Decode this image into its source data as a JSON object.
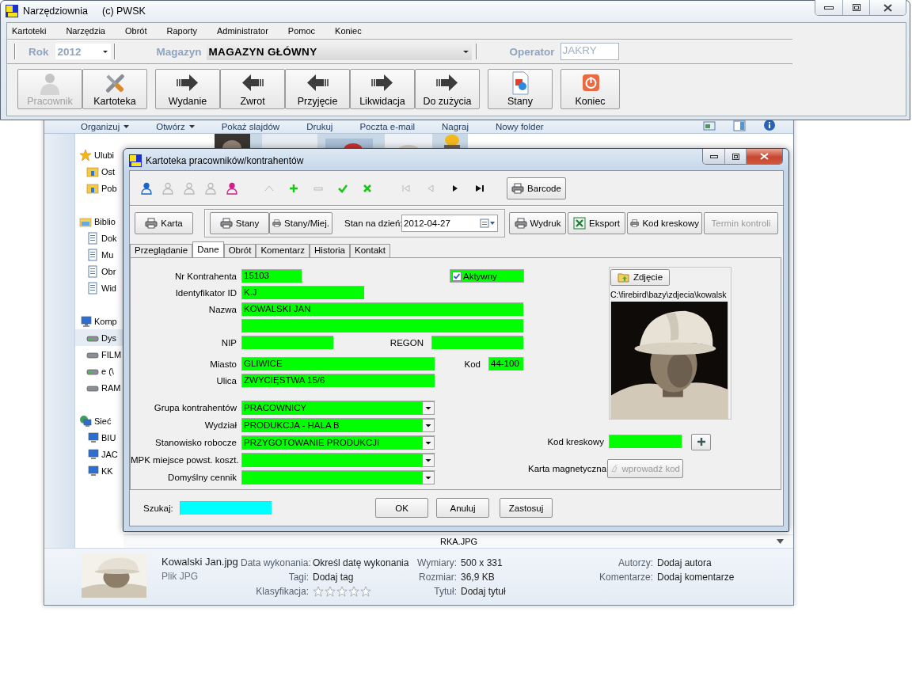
{
  "main_window": {
    "title": "Narzędziownia",
    "copyright": "(c) PWSK",
    "menu": [
      "Kartoteki",
      "Narzędzia",
      "Obrót",
      "Raporty",
      "Administrator",
      "Pomoc",
      "Koniec"
    ],
    "filters": {
      "year_label": "Rok",
      "year": "2012",
      "warehouse_label": "Magazyn",
      "warehouse": "MAGAZYN GŁÓWNY",
      "operator_label": "Operator",
      "operator": "JAKRY"
    },
    "toolbar_groups": [
      [
        {
          "label": "Pracownik",
          "kind": "person",
          "disabled": true
        },
        {
          "label": "Kartoteka",
          "kind": "tools",
          "disabled": false
        }
      ],
      [
        {
          "label": "Wydanie",
          "kind": "arrow-right",
          "disabled": false
        },
        {
          "label": "Zwrot",
          "kind": "arrow-left",
          "disabled": false
        },
        {
          "label": "Przyjęcie",
          "kind": "arrow-left",
          "disabled": false
        },
        {
          "label": "Likwidacja",
          "kind": "arrow-right",
          "disabled": false
        },
        {
          "label": "Do zużycia",
          "kind": "arrow-right",
          "disabled": false
        }
      ],
      [
        {
          "label": "Stany",
          "kind": "document",
          "disabled": false
        }
      ],
      [
        {
          "label": "Koniec",
          "kind": "power",
          "disabled": false
        }
      ]
    ]
  },
  "explorer": {
    "toolbar": [
      {
        "label": "Organizuj",
        "dropdown": true
      },
      {
        "label": "Otwórz",
        "dropdown": true
      },
      {
        "label": "Pokaż slajdów",
        "dropdown": false
      },
      {
        "label": "Drukuj",
        "dropdown": false
      },
      {
        "label": "Poczta e-mail",
        "dropdown": false
      },
      {
        "label": "Nagraj",
        "dropdown": false
      },
      {
        "label": "Nowy folder",
        "dropdown": false
      }
    ],
    "nav": [
      {
        "label": "Ulubi",
        "selected": false,
        "children": [
          {
            "label": "Ost",
            "selected": false
          },
          {
            "label": "Pob",
            "selected": false
          }
        ]
      },
      {
        "label": "Biblio",
        "selected": false,
        "children": [
          {
            "label": "Dok",
            "selected": false
          },
          {
            "label": "Mu",
            "selected": false
          },
          {
            "label": "Obr",
            "selected": false
          },
          {
            "label": "Wid",
            "selected": false
          }
        ]
      },
      {
        "label": "Komp",
        "selected": false,
        "children": [
          {
            "label": "Dys",
            "selected": true
          },
          {
            "label": "FILM",
            "selected": false
          },
          {
            "label": "e (\\",
            "selected": false
          },
          {
            "label": "RAM",
            "selected": false
          }
        ]
      },
      {
        "label": "Sieć",
        "selected": false,
        "children": [
          {
            "label": "BIU",
            "selected": false
          },
          {
            "label": "JAC",
            "selected": false
          },
          {
            "label": "KK",
            "selected": false
          }
        ]
      }
    ],
    "file_row": "RKA.JPG",
    "details": {
      "file_name": "Kowalski Jan.jpg",
      "file_type": "Plik JPG",
      "columns": [
        [
          {
            "kind": "text",
            "label": "Data wykonania:",
            "value": "Określ datę wykonania"
          },
          {
            "kind": "text",
            "label": "Tagi:",
            "value": "Dodaj tag"
          },
          {
            "kind": "rating",
            "label": "Klasyfikacja:",
            "stars": 0
          }
        ],
        [
          {
            "kind": "text",
            "label": "Wymiary:",
            "value": "500 x 331"
          },
          {
            "kind": "text",
            "label": "Rozmiar:",
            "value": "36,9 KB"
          },
          {
            "kind": "text",
            "label": "Tytuł:",
            "value": "Dodaj tytuł"
          }
        ],
        [
          {
            "kind": "text",
            "label": "Autorzy:",
            "value": "Dodaj autora"
          },
          {
            "kind": "text",
            "label": "Komentarze:",
            "value": "Dodaj komentarze"
          }
        ]
      ]
    }
  },
  "dialog": {
    "title": "Kartoteka pracowników/kontrahentów",
    "toolbar_groups": [
      [
        {
          "kind": "person-help",
          "disabled": false
        },
        {
          "kind": "person",
          "disabled": true
        },
        {
          "kind": "person-edit",
          "disabled": true
        },
        {
          "kind": "person",
          "disabled": true
        },
        {
          "kind": "person-pink",
          "disabled": false
        }
      ],
      [
        {
          "kind": "up",
          "disabled": true
        },
        {
          "kind": "plus",
          "disabled": false
        },
        {
          "kind": "minus",
          "disabled": true
        },
        {
          "kind": "check",
          "disabled": false
        },
        {
          "kind": "cross",
          "disabled": false
        }
      ],
      [
        {
          "kind": "first",
          "disabled": true
        },
        {
          "kind": "prev",
          "disabled": true
        },
        {
          "kind": "next",
          "disabled": false
        },
        {
          "kind": "last",
          "disabled": false
        }
      ]
    ],
    "barcode_button": "Barcode",
    "card_button": "Karta",
    "stock_buttons": [
      "Stany",
      "Stany/Miej."
    ],
    "date_label": "Stan na dzień:",
    "date": "2012-04-27",
    "report_buttons": [
      {
        "label": "Wydruk",
        "kind": "printer",
        "disabled": false
      },
      {
        "label": "Eksport",
        "kind": "spreadsheet",
        "disabled": false
      },
      {
        "label": "Kod kreskowy",
        "kind": "printer",
        "disabled": false
      },
      {
        "label": "Termin kontroli",
        "kind": "plain",
        "disabled": true
      }
    ],
    "tabs": [
      {
        "label": "Przeglądanie",
        "selected": false
      },
      {
        "label": "Dane",
        "selected": true
      },
      {
        "label": "Obrót",
        "selected": false
      },
      {
        "label": "Komentarz",
        "selected": false
      },
      {
        "label": "Historia",
        "selected": false
      },
      {
        "label": "Kontakt",
        "selected": false
      }
    ],
    "form": {
      "number": {
        "label": "Nr Kontrahenta",
        "value": "15103"
      },
      "active": {
        "label": "Aktywny",
        "checked": true
      },
      "identifier": {
        "label": "Identyfikator ID",
        "value": "K.J"
      },
      "name": {
        "label": "Nazwa",
        "value": "KOWALSKI JAN"
      },
      "nip": {
        "label": "NIP"
      },
      "regon": {
        "label": "REGON"
      },
      "city": {
        "label": "Miasto",
        "value": "GLIWICE"
      },
      "postcode": {
        "label": "Kod",
        "value": "44-100"
      },
      "street": {
        "label": "Ulica",
        "value": "ZWYCIĘSTWA 15/6"
      },
      "dropdowns": [
        {
          "label": "Grupa kontrahentów",
          "value": "PRACOWNICY"
        },
        {
          "label": "Wydział",
          "value": "PRODUKCJA - HALA B"
        },
        {
          "label": "Stanowisko robocze",
          "value": "PRZYGOTOWANIE PRODUKCJI"
        },
        {
          "label": "MPK miejsce powst. koszt."
        },
        {
          "label": "Domyślny cennik"
        }
      ],
      "photo": {
        "button": "Zdjęcie",
        "path": "C:\\firebird\\bazy\\zdjecia\\kowalsk"
      },
      "barcode": {
        "label": "Kod kreskowy"
      },
      "magnetic_card": {
        "label": "Karta magnetyczna",
        "button": "wprowadź kod",
        "disabled": true
      }
    },
    "search_label": "Szukaj:",
    "buttons": [
      "OK",
      "Anuluj",
      "Zastosuj"
    ]
  }
}
